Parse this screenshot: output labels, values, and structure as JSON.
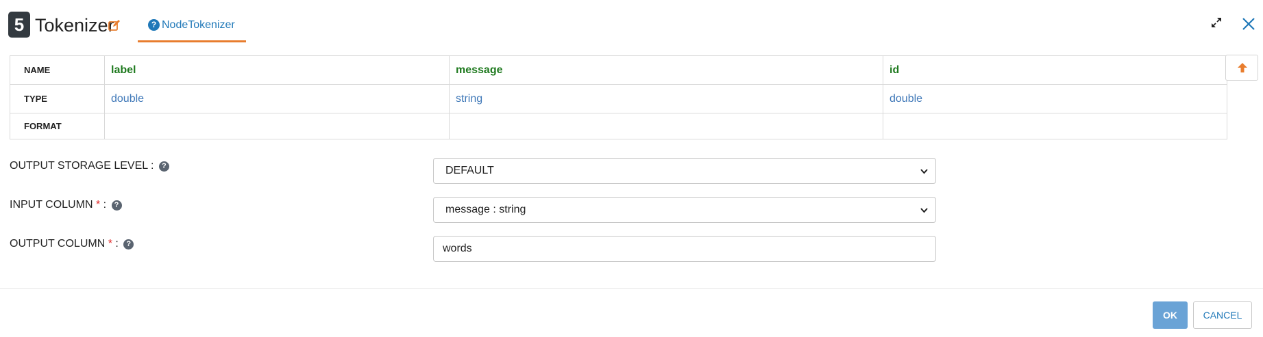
{
  "header": {
    "step_number": "5",
    "node_title": "Tokenizer",
    "tab_label": "NodeTokenizer",
    "tab_help_glyph": "?",
    "accent_color": "#e87d2e",
    "link_color": "#1f78b8"
  },
  "schema": {
    "row_labels": {
      "name": "NAME",
      "type": "TYPE",
      "format": "FORMAT"
    },
    "columns": [
      {
        "name": "label",
        "type": "double",
        "format": ""
      },
      {
        "name": "message",
        "type": "string",
        "format": ""
      },
      {
        "name": "id",
        "type": "double",
        "format": ""
      }
    ],
    "name_color": "#1f7a1f",
    "type_color": "#3f78b8"
  },
  "form": {
    "output_storage_level": {
      "label": "OUTPUT STORAGE LEVEL",
      "separator": " :",
      "value": "DEFAULT"
    },
    "input_column": {
      "label": "INPUT COLUMN",
      "required_mark": "*",
      "separator": " :",
      "value": "message : string"
    },
    "output_column": {
      "label": "OUTPUT COLUMN",
      "required_mark": "*",
      "separator": " :",
      "value": "words"
    },
    "help_glyph": "?"
  },
  "footer": {
    "ok_label": "OK",
    "cancel_label": "CANCEL"
  },
  "icons": {
    "edit": "edit-icon",
    "help": "question-circle-icon",
    "expand": "expand-icon",
    "close": "close-icon",
    "scroll_up": "arrow-up-icon",
    "dropdown": "chevron-down-icon"
  }
}
